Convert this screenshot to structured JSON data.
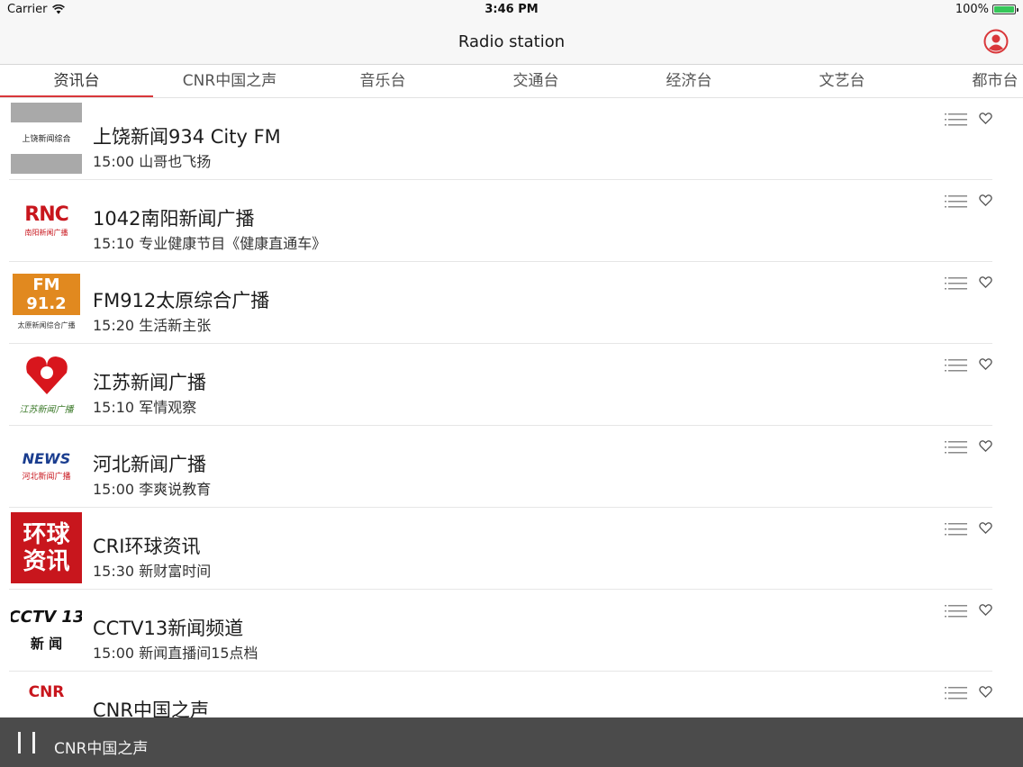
{
  "status_bar": {
    "carrier": "Carrier",
    "time": "3:46 PM",
    "battery": "100%",
    "battery_level": 1.0
  },
  "nav": {
    "title": "Radio station",
    "user_icon": "user-icon"
  },
  "tabs": [
    {
      "label": "资讯台"
    },
    {
      "label": "CNR中国之声"
    },
    {
      "label": "音乐台"
    },
    {
      "label": "交通台"
    },
    {
      "label": "经济台"
    },
    {
      "label": "文艺台"
    },
    {
      "label": "都市台"
    }
  ],
  "active_tab": 0,
  "accent_color": "#d9373a",
  "stations": [
    {
      "name": "上饶新闻934 City FM",
      "program": "15:00  山哥也飞扬",
      "logo_text": "上饶新闻综合"
    },
    {
      "name": "1042南阳新闻广播",
      "program": "15:10  专业健康节目《健康直通车》",
      "logo_text": "RNC",
      "logo_sub": "南阳新闻广播"
    },
    {
      "name": "FM912太原综合广播",
      "program": "15:20  生活新主张",
      "logo_text": "FM 91.2",
      "logo_sub": "太原新闻综合广播"
    },
    {
      "name": "江苏新闻广播",
      "program": "15:10  军情观察",
      "logo_sub": "江苏新闻广播"
    },
    {
      "name": "河北新闻广播",
      "program": "15:00  李爽说教育",
      "logo_text": "NEWS",
      "logo_sub": "河北新闻广播"
    },
    {
      "name": "CRI环球资讯",
      "program": "15:30  新财富时间",
      "logo_text": "环球资讯"
    },
    {
      "name": "CCTV13新闻频道",
      "program": "15:00  新闻直播间15点档",
      "logo_text": "CCTV 13",
      "logo_sub": "新 闻"
    },
    {
      "name": "CNR中国之声",
      "program": "",
      "logo_text": "CNR"
    }
  ],
  "player": {
    "now_playing": "CNR中国之声",
    "state_icon": "pause-icon"
  }
}
